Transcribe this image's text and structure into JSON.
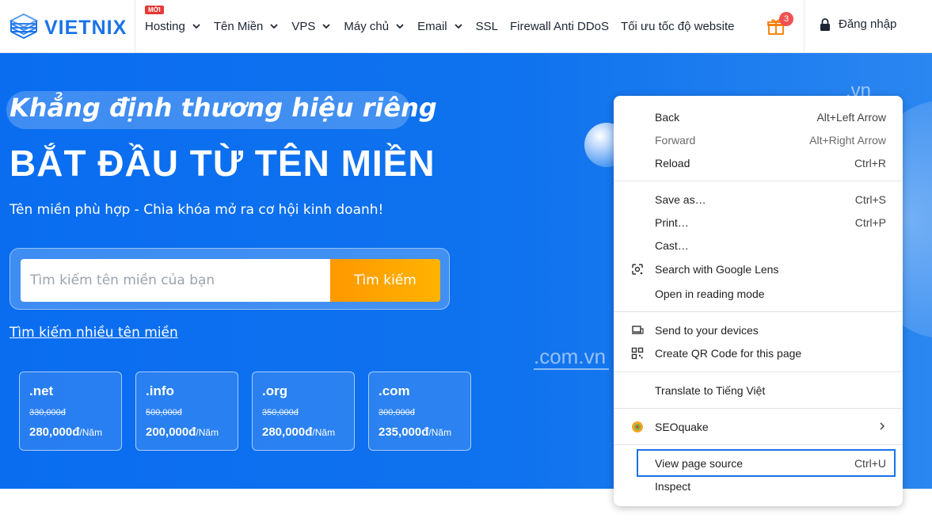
{
  "header": {
    "logo_text": "VIETNIX",
    "nav": [
      {
        "label": "Hosting",
        "badge": "MỚI",
        "dropdown": true
      },
      {
        "label": "Tên Miền",
        "dropdown": true
      },
      {
        "label": "VPS",
        "dropdown": true
      },
      {
        "label": "Máy chủ",
        "dropdown": true
      },
      {
        "label": "Email",
        "dropdown": true
      },
      {
        "label": "SSL",
        "dropdown": false
      },
      {
        "label": "Firewall Anti DDoS",
        "dropdown": false
      },
      {
        "label": "Tối ưu tốc độ website",
        "dropdown": false
      }
    ],
    "gift_count": "3",
    "login_label": "Đăng nhập"
  },
  "hero": {
    "tagline": "Khẳng định thương hiệu riêng",
    "headline": "BẮT ĐẦU TỪ TÊN MIỀN",
    "subline": "Tên miền phù hợp - Chìa khóa mở ra cơ hội kinh doanh!",
    "search_placeholder": "Tìm kiếm tên miền của bạn",
    "search_button": "Tìm kiếm",
    "multi_search_link": "Tìm kiếm nhiều tên miền",
    "deco_vn": ".vn",
    "deco_comvn": ".com.vn",
    "domains": [
      {
        "tld": ".net",
        "old_price": "330,000đ",
        "new_price": "280,000đ",
        "unit": "/Năm"
      },
      {
        "tld": ".info",
        "old_price": "500,000đ",
        "new_price": "200,000đ",
        "unit": "/Năm"
      },
      {
        "tld": ".org",
        "old_price": "350,000đ",
        "new_price": "280,000đ",
        "unit": "/Năm"
      },
      {
        "tld": ".com",
        "old_price": "300,000đ",
        "new_price": "235,000đ",
        "unit": "/Năm"
      }
    ]
  },
  "context_menu": {
    "back": {
      "label": "Back",
      "shortcut": "Alt+Left Arrow"
    },
    "forward": {
      "label": "Forward",
      "shortcut": "Alt+Right Arrow"
    },
    "reload": {
      "label": "Reload",
      "shortcut": "Ctrl+R"
    },
    "save_as": {
      "label": "Save as…",
      "shortcut": "Ctrl+S"
    },
    "print": {
      "label": "Print…",
      "shortcut": "Ctrl+P"
    },
    "cast": {
      "label": "Cast…"
    },
    "google_lens": {
      "label": "Search with Google Lens"
    },
    "reading_mode": {
      "label": "Open in reading mode"
    },
    "send_devices": {
      "label": "Send to your devices"
    },
    "qr_code": {
      "label": "Create QR Code for this page"
    },
    "translate": {
      "label": "Translate to Tiếng Việt"
    },
    "seoquake": {
      "label": "SEOquake"
    },
    "view_source": {
      "label": "View page source",
      "shortcut": "Ctrl+U"
    },
    "inspect": {
      "label": "Inspect"
    }
  },
  "colors": {
    "brand": "#1a73e8",
    "hero_bg": "#0a6df0",
    "search_button": "#ff9800",
    "highlight_border": "#1a73e8"
  }
}
